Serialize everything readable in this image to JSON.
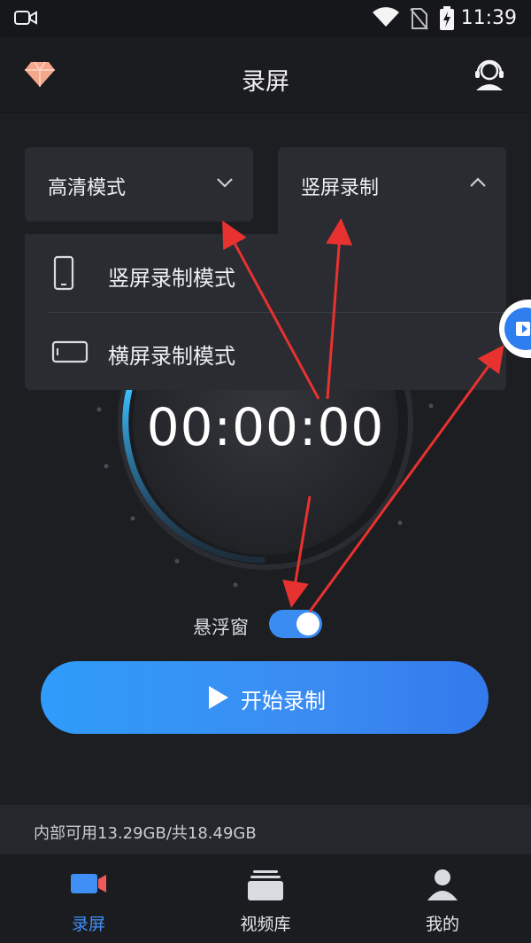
{
  "status_bar": {
    "time": "11:39"
  },
  "header": {
    "title": "录屏"
  },
  "modes": {
    "quality_label": "高清模式",
    "orientation_label": "竖屏录制",
    "options": [
      "竖屏录制模式",
      "横屏录制模式"
    ]
  },
  "timer": "00:00:00",
  "floating_window": {
    "label": "悬浮窗",
    "enabled": true
  },
  "start_button": {
    "label": "开始录制"
  },
  "storage": {
    "text": "内部可用13.29GB/共18.49GB"
  },
  "nav": {
    "items": [
      {
        "label": "录屏",
        "icon": "video-camera-icon",
        "active": true
      },
      {
        "label": "视频库",
        "icon": "video-library-icon",
        "active": false
      },
      {
        "label": "我的",
        "icon": "user-icon",
        "active": false
      }
    ]
  },
  "colors": {
    "accent": "#3a8cf0",
    "background": "#1d1e22",
    "panel": "#2a2c32",
    "annotation": "#e8322f"
  }
}
